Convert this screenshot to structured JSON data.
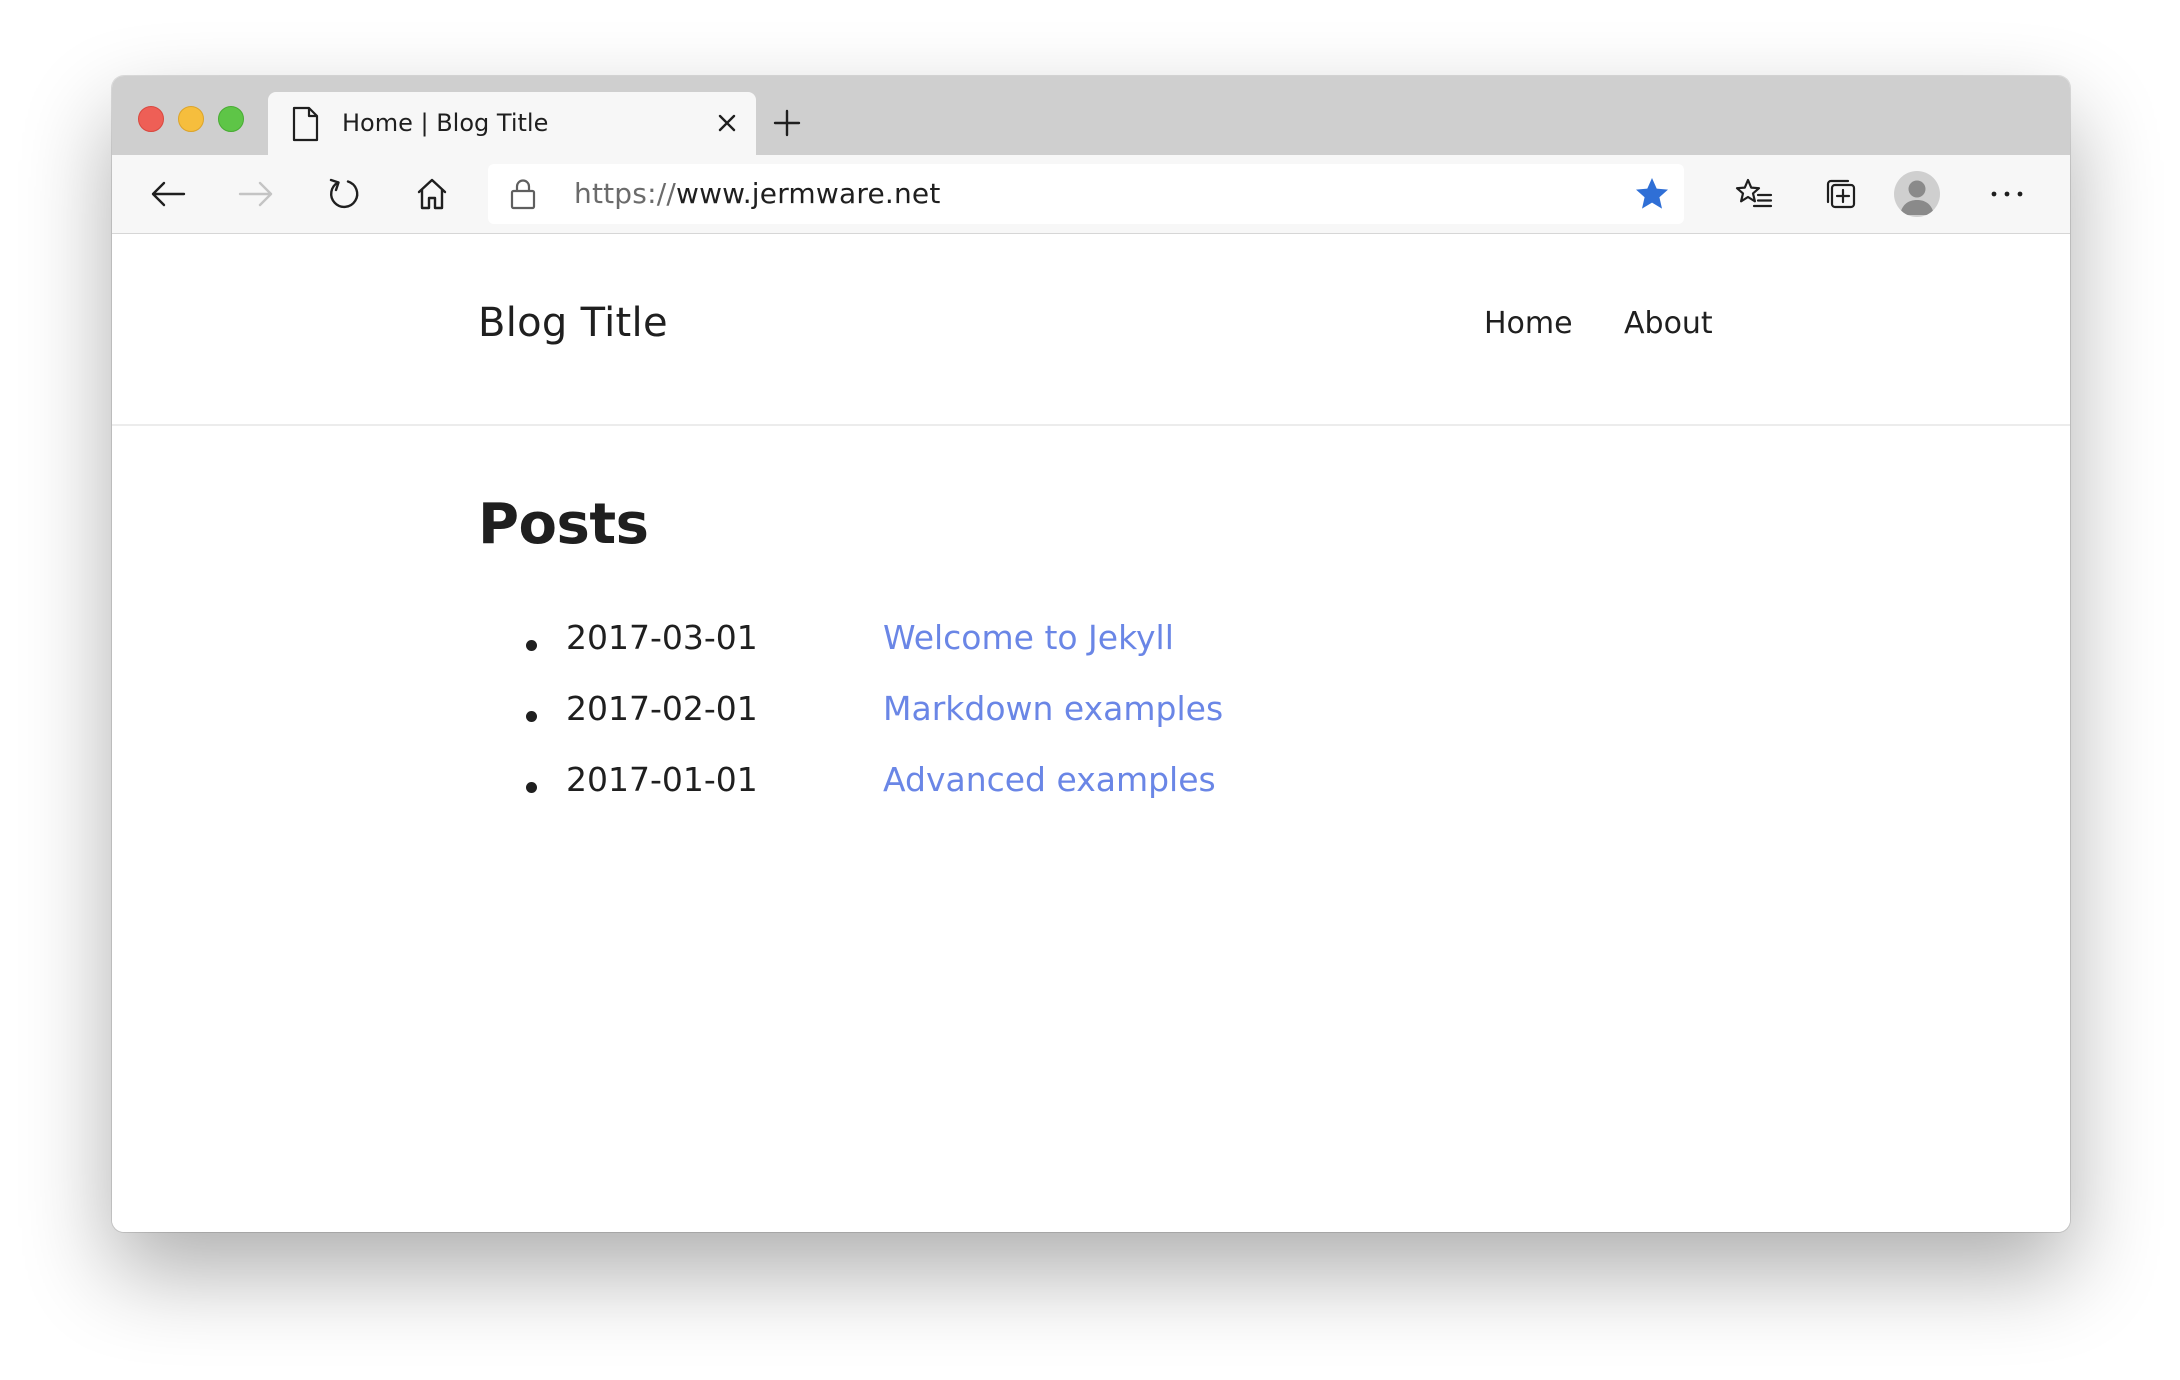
{
  "browser": {
    "tab": {
      "title": "Home | Blog Title",
      "icon": "document-icon",
      "close_icon": "close-icon"
    },
    "new_tab_icon": "plus-icon",
    "toolbar": {
      "back_icon": "arrow-left-icon",
      "forward_icon": "arrow-right-icon",
      "reload_icon": "reload-icon",
      "home_icon": "home-icon",
      "favorites_icon": "favorites-list-icon",
      "collections_icon": "collections-icon",
      "profile_icon": "profile-avatar-icon",
      "menu_icon": "more-icon"
    },
    "address_bar": {
      "scheme": "https://",
      "host": "www.jermware.net",
      "lock_icon": "lock-icon",
      "star_icon": "star-filled-icon"
    },
    "accent_color": "#2f6fd6"
  },
  "site": {
    "title": "Blog Title",
    "nav": [
      {
        "label": "Home"
      },
      {
        "label": "About"
      }
    ]
  },
  "posts": {
    "heading": "Posts",
    "items": [
      {
        "date": "2017-03-01",
        "title": "Welcome to Jekyll"
      },
      {
        "date": "2017-02-01",
        "title": "Markdown examples"
      },
      {
        "date": "2017-01-01",
        "title": "Advanced examples"
      }
    ],
    "link_color": "#6a86e6"
  }
}
